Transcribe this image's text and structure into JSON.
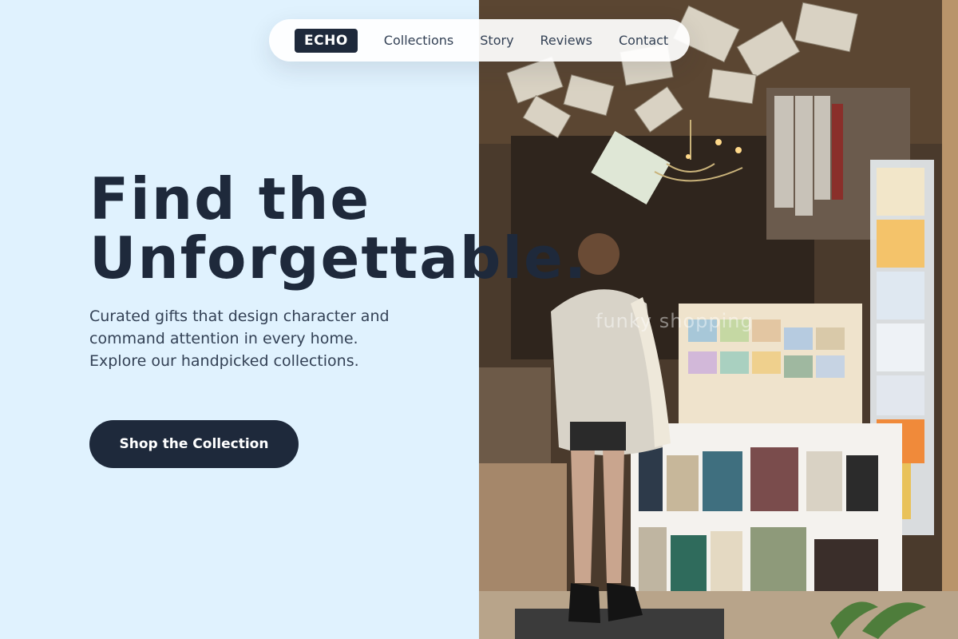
{
  "nav": {
    "brand": "ECHO",
    "links": [
      "Collections",
      "Story",
      "Reviews",
      "Contact"
    ]
  },
  "hero": {
    "title_line1": "Find the",
    "title_line2": "Unforgettable.",
    "subtitle": "Curated gifts that design character and command attention in every home. Explore our handpicked collections.",
    "cta_label": "Shop the Collection"
  },
  "photo": {
    "description_icon": "bookshop-photo",
    "watermark": "funky shopping"
  },
  "colors": {
    "background": "#e0f2fe",
    "dark": "#1e293b",
    "text": "#334155",
    "nav_bg": "#ffffff"
  }
}
